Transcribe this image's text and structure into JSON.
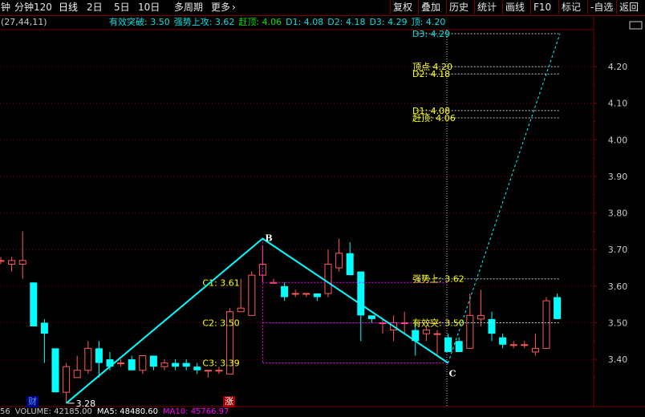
{
  "toolbar": {
    "items": [
      {
        "label": "钟",
        "selected": false
      },
      {
        "label": "分钟120",
        "selected": false
      },
      {
        "label": "日线",
        "selected": true
      },
      {
        "label": "2日",
        "selected": false
      },
      {
        "label": "5日",
        "selected": false
      },
      {
        "label": "10日",
        "selected": false
      },
      {
        "label": "多周期",
        "selected": false
      },
      {
        "label": "更多",
        "selected": false
      }
    ],
    "right": [
      "复权",
      "叠加",
      "历史",
      "统计",
      "画线",
      "F10",
      "标记",
      "-自选",
      "返回"
    ],
    "chevron_icon": "chevron-right-icon",
    "accent": "#7a0000"
  },
  "header": {
    "params": "(27,44,11)",
    "items": [
      {
        "label": "有效突破:",
        "value": "3.50",
        "color": "#00e0e0"
      },
      {
        "label": "强势上攻:",
        "value": "3.62",
        "color": "#00e0e0"
      },
      {
        "label": "赶顶:",
        "value": "4.06",
        "color": "#00e000"
      },
      {
        "label": "D1:",
        "value": "4.08",
        "color": "#00e0e0"
      },
      {
        "label": "D2:",
        "value": "4.18",
        "color": "#00e0e0"
      },
      {
        "label": "D3:",
        "value": "4.29",
        "color": "#00e0e0"
      },
      {
        "label": "顶:",
        "value": "4.20",
        "color": "#00e0e0"
      }
    ]
  },
  "chart_data": {
    "type": "candlestick",
    "ylim": [
      3.33,
      4.29
    ],
    "ticks": [
      "4.20",
      "4.10",
      "4.00",
      "3.90",
      "3.80",
      "3.70",
      "3.60",
      "3.50",
      "3.40"
    ],
    "tick_values": [
      4.2,
      4.1,
      4.0,
      3.9,
      3.8,
      3.7,
      3.6,
      3.5,
      3.4
    ],
    "candles": [
      {
        "o": 3.67,
        "h": 3.68,
        "l": 3.66,
        "c": 3.67
      },
      {
        "o": 3.66,
        "h": 3.68,
        "l": 3.64,
        "c": 3.67
      },
      {
        "o": 3.66,
        "h": 3.75,
        "l": 3.62,
        "c": 3.67
      },
      {
        "o": 3.61,
        "h": 3.61,
        "l": 3.49,
        "c": 3.49
      },
      {
        "o": 3.5,
        "h": 3.51,
        "l": 3.39,
        "c": 3.47
      },
      {
        "o": 3.43,
        "h": 3.43,
        "l": 3.31,
        "c": 3.31
      },
      {
        "o": 3.31,
        "h": 3.39,
        "l": 3.28,
        "c": 3.38
      },
      {
        "o": 3.35,
        "h": 3.41,
        "l": 3.35,
        "c": 3.37
      },
      {
        "o": 3.37,
        "h": 3.45,
        "l": 3.36,
        "c": 3.43
      },
      {
        "o": 3.43,
        "h": 3.45,
        "l": 3.35,
        "c": 3.39
      },
      {
        "o": 3.4,
        "h": 3.42,
        "l": 3.37,
        "c": 3.38
      },
      {
        "o": 3.39,
        "h": 3.4,
        "l": 3.38,
        "c": 3.39
      },
      {
        "o": 3.4,
        "h": 3.41,
        "l": 3.37,
        "c": 3.37
      },
      {
        "o": 3.37,
        "h": 3.41,
        "l": 3.36,
        "c": 3.41
      },
      {
        "o": 3.41,
        "h": 3.41,
        "l": 3.37,
        "c": 3.38
      },
      {
        "o": 3.38,
        "h": 3.4,
        "l": 3.37,
        "c": 3.39
      },
      {
        "o": 3.39,
        "h": 3.4,
        "l": 3.37,
        "c": 3.38
      },
      {
        "o": 3.39,
        "h": 3.4,
        "l": 3.37,
        "c": 3.38
      },
      {
        "o": 3.38,
        "h": 3.39,
        "l": 3.36,
        "c": 3.37
      },
      {
        "o": 3.37,
        "h": 3.37,
        "l": 3.35,
        "c": 3.37
      },
      {
        "o": 3.37,
        "h": 3.38,
        "l": 3.36,
        "c": 3.37
      },
      {
        "o": 3.36,
        "h": 3.54,
        "l": 3.36,
        "c": 3.53
      },
      {
        "o": 3.53,
        "h": 3.62,
        "l": 3.53,
        "c": 3.54
      },
      {
        "o": 3.52,
        "h": 3.64,
        "l": 3.52,
        "c": 3.63
      },
      {
        "o": 3.63,
        "h": 3.71,
        "l": 3.61,
        "c": 3.66
      },
      {
        "o": 3.61,
        "h": 3.62,
        "l": 3.61,
        "c": 3.61
      },
      {
        "o": 3.6,
        "h": 3.61,
        "l": 3.56,
        "c": 3.57
      },
      {
        "o": 3.58,
        "h": 3.59,
        "l": 3.57,
        "c": 3.58
      },
      {
        "o": 3.58,
        "h": 3.58,
        "l": 3.57,
        "c": 3.58
      },
      {
        "o": 3.58,
        "h": 3.58,
        "l": 3.56,
        "c": 3.57
      },
      {
        "o": 3.58,
        "h": 3.7,
        "l": 3.57,
        "c": 3.66
      },
      {
        "o": 3.65,
        "h": 3.73,
        "l": 3.64,
        "c": 3.69
      },
      {
        "o": 3.69,
        "h": 3.72,
        "l": 3.63,
        "c": 3.63
      },
      {
        "o": 3.64,
        "h": 3.64,
        "l": 3.45,
        "c": 3.52
      },
      {
        "o": 3.52,
        "h": 3.52,
        "l": 3.5,
        "c": 3.51
      },
      {
        "o": 3.5,
        "h": 3.51,
        "l": 3.47,
        "c": 3.5
      },
      {
        "o": 3.48,
        "h": 3.52,
        "l": 3.45,
        "c": 3.5
      },
      {
        "o": 3.5,
        "h": 3.53,
        "l": 3.47,
        "c": 3.5
      },
      {
        "o": 3.48,
        "h": 3.5,
        "l": 3.41,
        "c": 3.45
      },
      {
        "o": 3.47,
        "h": 3.49,
        "l": 3.45,
        "c": 3.48
      },
      {
        "o": 3.47,
        "h": 3.48,
        "l": 3.41,
        "c": 3.47
      },
      {
        "o": 3.46,
        "h": 3.47,
        "l": 3.42,
        "c": 3.42
      },
      {
        "o": 3.45,
        "h": 3.46,
        "l": 3.42,
        "c": 3.42
      },
      {
        "o": 3.43,
        "h": 3.58,
        "l": 3.43,
        "c": 3.52
      },
      {
        "o": 3.51,
        "h": 3.59,
        "l": 3.49,
        "c": 3.52
      },
      {
        "o": 3.51,
        "h": 3.53,
        "l": 3.45,
        "c": 3.47
      },
      {
        "o": 3.46,
        "h": 3.47,
        "l": 3.43,
        "c": 3.44
      },
      {
        "o": 3.44,
        "h": 3.45,
        "l": 3.43,
        "c": 3.44
      },
      {
        "o": 3.44,
        "h": 3.45,
        "l": 3.43,
        "c": 3.44
      },
      {
        "o": 3.42,
        "h": 3.47,
        "l": 3.41,
        "c": 3.43
      },
      {
        "o": 3.43,
        "h": 3.57,
        "l": 3.43,
        "c": 3.56
      },
      {
        "o": 3.57,
        "h": 3.58,
        "l": 3.51,
        "c": 3.51
      }
    ],
    "abcd": {
      "points": [
        {
          "label": "A",
          "i": 6,
          "price": 3.28,
          "value_label": "3.28"
        },
        {
          "label": "B",
          "i": 24,
          "price": 3.73,
          "value_label": ""
        },
        {
          "label": "C",
          "i": 41,
          "price": 3.39,
          "value_label": ""
        }
      ],
      "projection_to": {
        "i": 53,
        "price": 4.29
      }
    },
    "levels_left": [
      {
        "label": "C1: 3.61",
        "price": 3.61
      },
      {
        "label": "C2: 3.50",
        "price": 3.5
      },
      {
        "label": "C3: 3.39",
        "price": 3.39
      }
    ],
    "levels_right": [
      {
        "label": "D3: 4.29",
        "price": 4.29,
        "color": "#00e0e0"
      },
      {
        "label": "顶点 4.20",
        "price": 4.2,
        "color": "#ffff00"
      },
      {
        "label": "D2: 4.18",
        "price": 4.18,
        "color": "#ffff00"
      },
      {
        "label": "D1: 4.08",
        "price": 4.08,
        "color": "#ffff00"
      },
      {
        "label": "赶顶: 4.06",
        "price": 4.06,
        "color": "#ffff00"
      },
      {
        "label": "强势上: 3.62",
        "price": 3.62,
        "color": "#ffff00"
      },
      {
        "label": "有效突: 3.50",
        "price": 3.5,
        "color": "#ffff00"
      }
    ],
    "colors": {
      "up": "#ff5a5a",
      "down": "#00ffff",
      "grid": "#7a0000",
      "abc": "#00ffff",
      "magenta": "#ff00ff",
      "text": "#ffff00",
      "axis": "#c8c8c8"
    },
    "legend": "none",
    "grid": true
  },
  "badges": [
    {
      "label": "财",
      "color": "#40a0ff",
      "bg": "#000080"
    },
    {
      "label": "涨",
      "color": "#ffffff",
      "bg": "#a00000"
    }
  ],
  "volume": {
    "items": [
      {
        "text": "56",
        "color": "#c8c8c8"
      },
      {
        "text": "VOLUME: 42185.00",
        "color": "#c8c8c8"
      },
      {
        "text": "MA5: 48480.60",
        "color": "#ffffff"
      },
      {
        "text": "MA10: 45766.97",
        "color": "#ff00ff"
      }
    ]
  }
}
